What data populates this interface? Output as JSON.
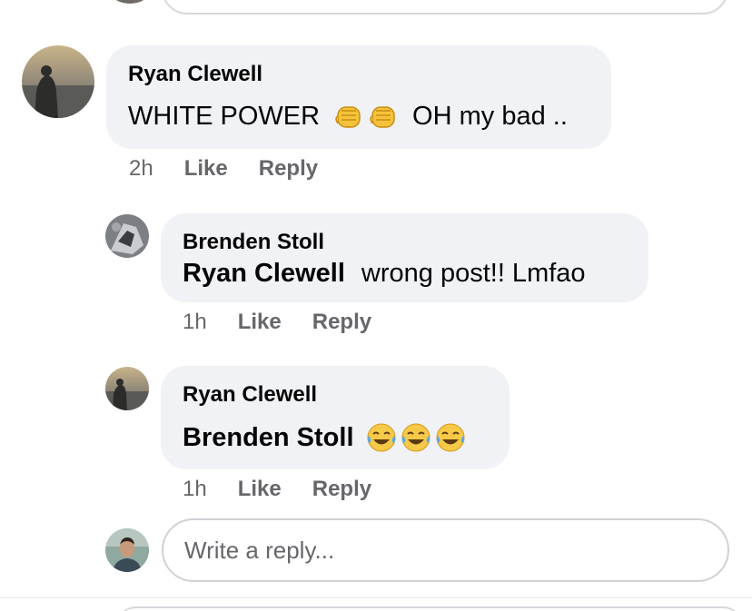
{
  "comments": [
    {
      "author": "Ryan Clewell",
      "text": "WHITE POWER",
      "emoji_icons": [
        "raised-fist-emoji",
        "raised-fist-emoji"
      ],
      "text_after": "OH my bad ..",
      "time": "2h",
      "like_label": "Like",
      "reply_label": "Reply"
    }
  ],
  "replies": [
    {
      "author": "Brenden Stoll",
      "mention": "Ryan Clewell",
      "text": "wrong post!! Lmfao",
      "time": "1h",
      "like_label": "Like",
      "reply_label": "Reply"
    },
    {
      "author": "Ryan Clewell",
      "mention": "Brenden Stoll",
      "emoji_icons": [
        "tears-of-joy-emoji",
        "tears-of-joy-emoji",
        "tears-of-joy-emoji"
      ],
      "time": "1h",
      "like_label": "Like",
      "reply_label": "Reply"
    }
  ],
  "reply_input": {
    "placeholder": "Write a reply..."
  },
  "colors": {
    "bubble": "#f0f2f5",
    "meta_text": "#65676b",
    "input_border": "#cfd1d5"
  }
}
